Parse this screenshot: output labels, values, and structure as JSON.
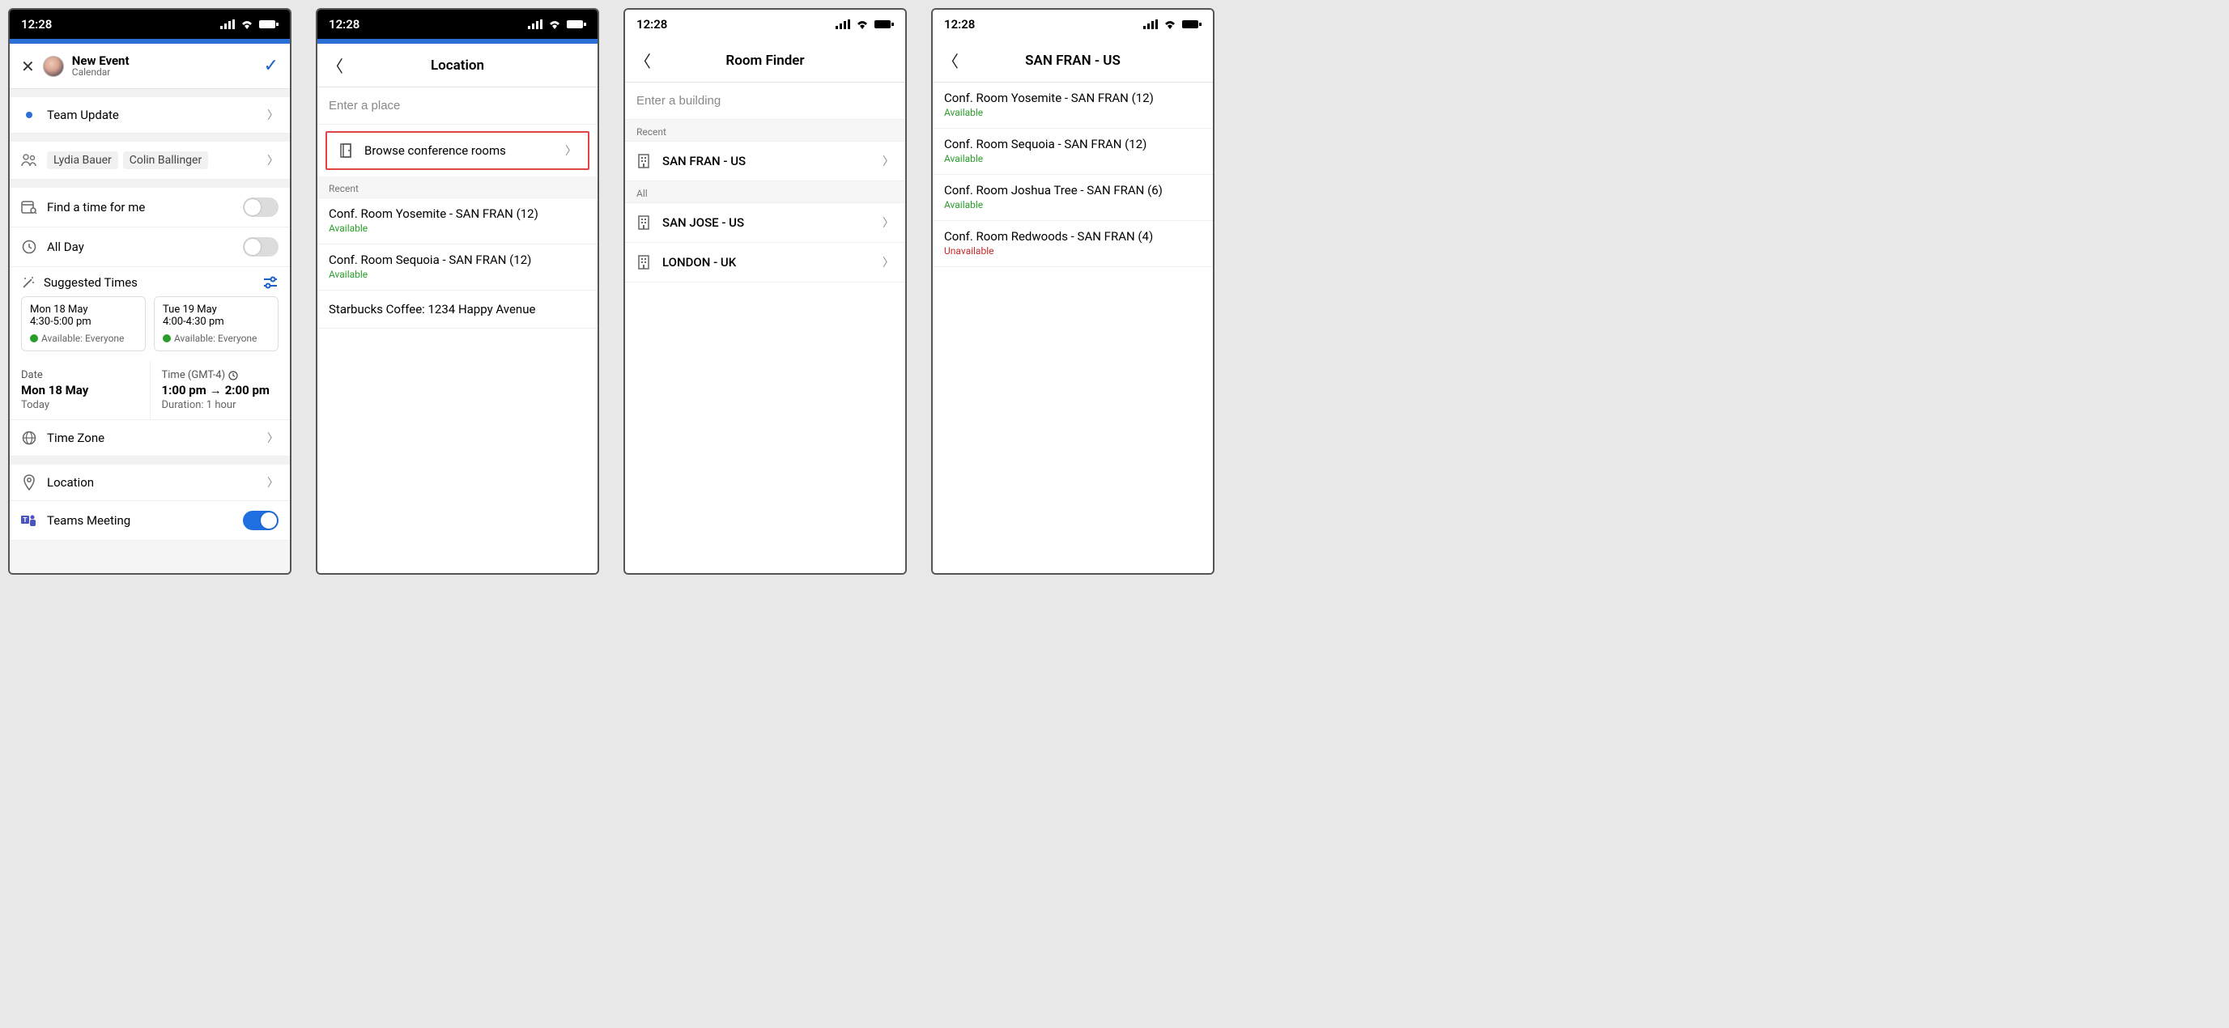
{
  "status": {
    "time": "12:28"
  },
  "screen1": {
    "title": "New Event",
    "subtitle": "Calendar",
    "event_title": "Team Update",
    "attendees": [
      "Lydia Bauer",
      "Colin Ballinger"
    ],
    "find_time_label": "Find a time for me",
    "all_day_label": "All Day",
    "suggested_label": "Suggested Times",
    "suggestions": [
      {
        "date": "Mon 18 May",
        "time": "4:30-5:00 pm",
        "avail": "Available: Everyone"
      },
      {
        "date": "Tue 19 May",
        "time": "4:00-4:30 pm",
        "avail": "Available: Everyone"
      }
    ],
    "date_label": "Date",
    "date_value": "Mon 18 May",
    "date_sub": "Today",
    "time_label": "Time (GMT-4)",
    "time_start": "1:00 pm",
    "time_end": "2:00 pm",
    "time_sub": "Duration: 1 hour",
    "timezone_label": "Time Zone",
    "location_label": "Location",
    "teams_label": "Teams Meeting"
  },
  "screen2": {
    "title": "Location",
    "placeholder": "Enter a place",
    "browse_label": "Browse conference rooms",
    "recent_label": "Recent",
    "rooms": [
      {
        "name": "Conf. Room Yosemite - SAN FRAN (12)",
        "status": "Available",
        "avail": true
      },
      {
        "name": "Conf. Room Sequoia - SAN FRAN (12)",
        "status": "Available",
        "avail": true
      }
    ],
    "place": "Starbucks Coffee: 1234 Happy Avenue"
  },
  "screen3": {
    "title": "Room Finder",
    "placeholder": "Enter a building",
    "recent_label": "Recent",
    "all_label": "All",
    "recent": [
      {
        "name": "SAN FRAN - US"
      }
    ],
    "all": [
      {
        "name": "SAN JOSE - US"
      },
      {
        "name": "LONDON - UK"
      }
    ]
  },
  "screen4": {
    "title": "SAN FRAN - US",
    "rooms": [
      {
        "name": "Conf. Room Yosemite - SAN FRAN (12)",
        "status": "Available",
        "avail": true
      },
      {
        "name": "Conf. Room Sequoia - SAN FRAN (12)",
        "status": "Available",
        "avail": true
      },
      {
        "name": "Conf. Room Joshua Tree - SAN FRAN (6)",
        "status": "Available",
        "avail": true
      },
      {
        "name": "Conf. Room Redwoods - SAN FRAN (4)",
        "status": "Unavailable",
        "avail": false
      }
    ]
  }
}
